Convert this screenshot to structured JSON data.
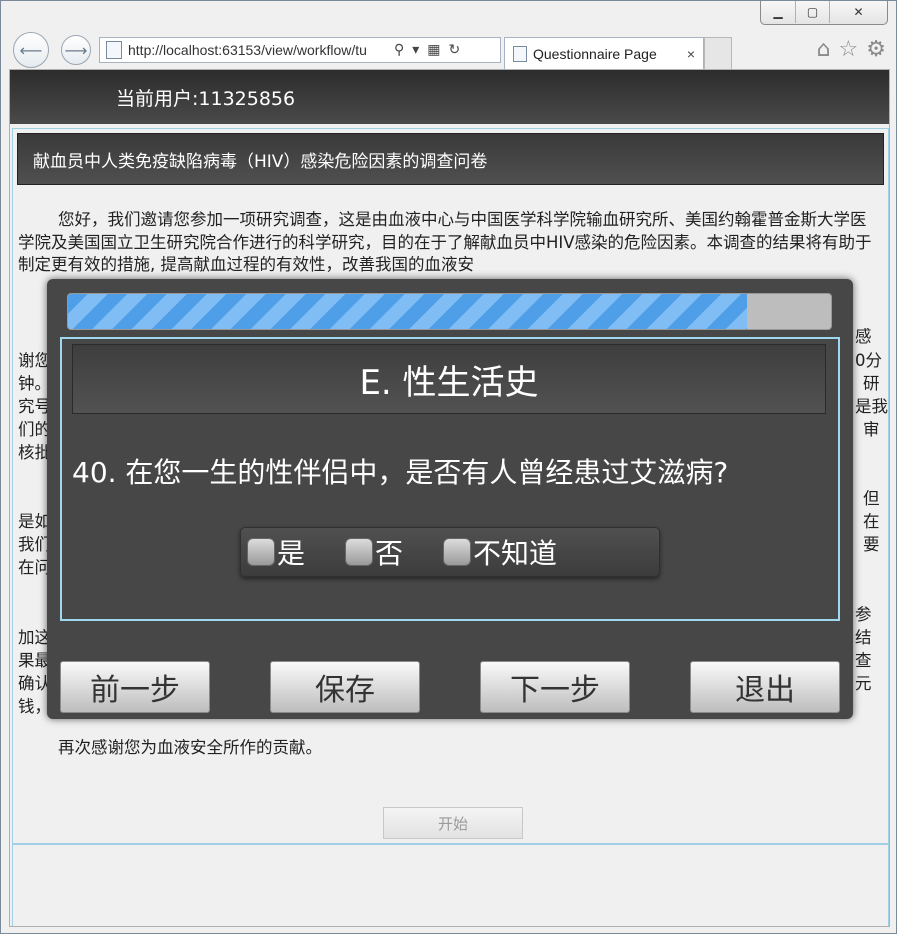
{
  "browser": {
    "url": "http://localhost:63153/view/workflow/tu",
    "tab_title": "Questionnaire Page",
    "tab_close": "×"
  },
  "page": {
    "current_user": "当前用户:11325856",
    "survey_title": "献血员中人类免疫缺陷病毒（HIV）感染危险因素的调查问卷",
    "paragraphs": [
      "您好，我们邀请您参加一项研究调查，这是由血液中心与中国医学科学院输血研究所、美国约翰霍普金斯大学医学院及美国国立卫生研究院合作进行的科学研究，目的在于了解献血员中HIV感染的危险因素。本调查的结果将有助于制定更有效的措施, 提高献血过程的有效性，改善我国的血液安",
      "感",
      "谢您",
      "0分",
      "钟。",
      "研",
      "究号",
      "是我",
      "们的",
      "审",
      "核批",
      "但",
      "是如",
      "在",
      "我们",
      "要",
      "在问",
      "参",
      "加这",
      "结",
      "果最",
      "查",
      "确认",
      "元",
      "钱，"
    ],
    "closing": "再次感谢您为血液安全所作的贡献。",
    "start_button": "开始"
  },
  "modal": {
    "progress_percent": 89,
    "section_title": "E. 性生活史",
    "question": "40. 在您一生的性伴侣中，是否有人曾经患过艾滋病?",
    "options": [
      "是",
      "否",
      "不知道"
    ],
    "buttons": {
      "prev": "前一步",
      "save": "保存",
      "next": "下一步",
      "exit": "退出"
    }
  }
}
